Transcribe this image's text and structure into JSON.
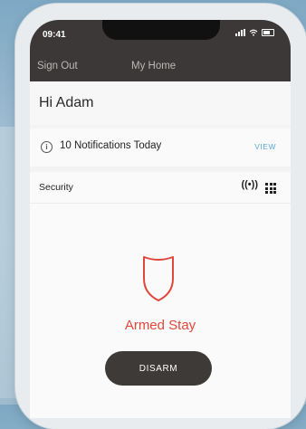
{
  "status_bar": {
    "time": "09:41"
  },
  "nav": {
    "sign_out": "Sign Out",
    "title": "My Home"
  },
  "greeting": "Hi Adam",
  "notifications": {
    "text": "10 Notifications Today",
    "view": "VIEW"
  },
  "security": {
    "title": "Security",
    "status": "Armed Stay",
    "disarm_label": "DISARM",
    "status_color": "#e0463b"
  },
  "icons": {
    "info": "info-icon",
    "radio": "radio-signal-icon",
    "grid": "grid-icon",
    "shield": "shield-icon"
  }
}
